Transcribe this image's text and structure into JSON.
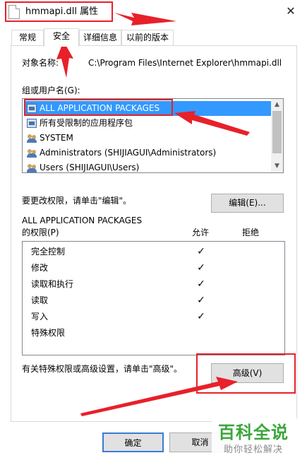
{
  "window": {
    "title": "hmmapi.dll 属性",
    "close_glyph": "✕"
  },
  "tabs": [
    {
      "label": "常规",
      "selected": false
    },
    {
      "label": "安全",
      "selected": true
    },
    {
      "label": "详细信息",
      "selected": false
    },
    {
      "label": "以前的版本",
      "selected": false
    }
  ],
  "object": {
    "label": "对象名称:",
    "value": "C:\\Program Files\\Internet Explorer\\hmmapi.dll"
  },
  "groups": {
    "label": "组或用户名(G):",
    "items": [
      {
        "name": "ALL APPLICATION PACKAGES",
        "icon": "package-icon",
        "selected": true
      },
      {
        "name": "所有受限制的应用程序包",
        "icon": "package-icon",
        "selected": false
      },
      {
        "name": "SYSTEM",
        "icon": "group-icon",
        "selected": false
      },
      {
        "name": "Administrators (SHIJIAGUI\\Administrators)",
        "icon": "group-icon",
        "selected": false
      },
      {
        "name": "Users (SHIJIAGUI\\Users)",
        "icon": "group-icon",
        "selected": false
      }
    ]
  },
  "edit": {
    "hint": "要更改权限，请单击\"编辑\"。",
    "button_label": "编辑(E)..."
  },
  "permissions": {
    "subject": "ALL APPLICATION PACKAGES",
    "heading": "的权限(P)",
    "allow_label": "允许",
    "deny_label": "拒绝",
    "check_glyph": "✓",
    "rows": [
      {
        "name": "完全控制",
        "allow": true,
        "deny": false
      },
      {
        "name": "修改",
        "allow": true,
        "deny": false
      },
      {
        "name": "读取和执行",
        "allow": true,
        "deny": false
      },
      {
        "name": "读取",
        "allow": true,
        "deny": false
      },
      {
        "name": "写入",
        "allow": true,
        "deny": false
      },
      {
        "name": "特殊权限",
        "allow": false,
        "deny": false
      }
    ]
  },
  "advanced": {
    "hint": "有关特殊权限或高级设置，请单击\"高级\"。",
    "button_label": "高级(V)"
  },
  "footer": {
    "ok_label": "确定",
    "cancel_label": "取消"
  },
  "watermark": {
    "main": "百科全说",
    "sub": "助你轻松解决"
  },
  "annotation_color": "#e8202a",
  "selection_color": "#3399ff"
}
